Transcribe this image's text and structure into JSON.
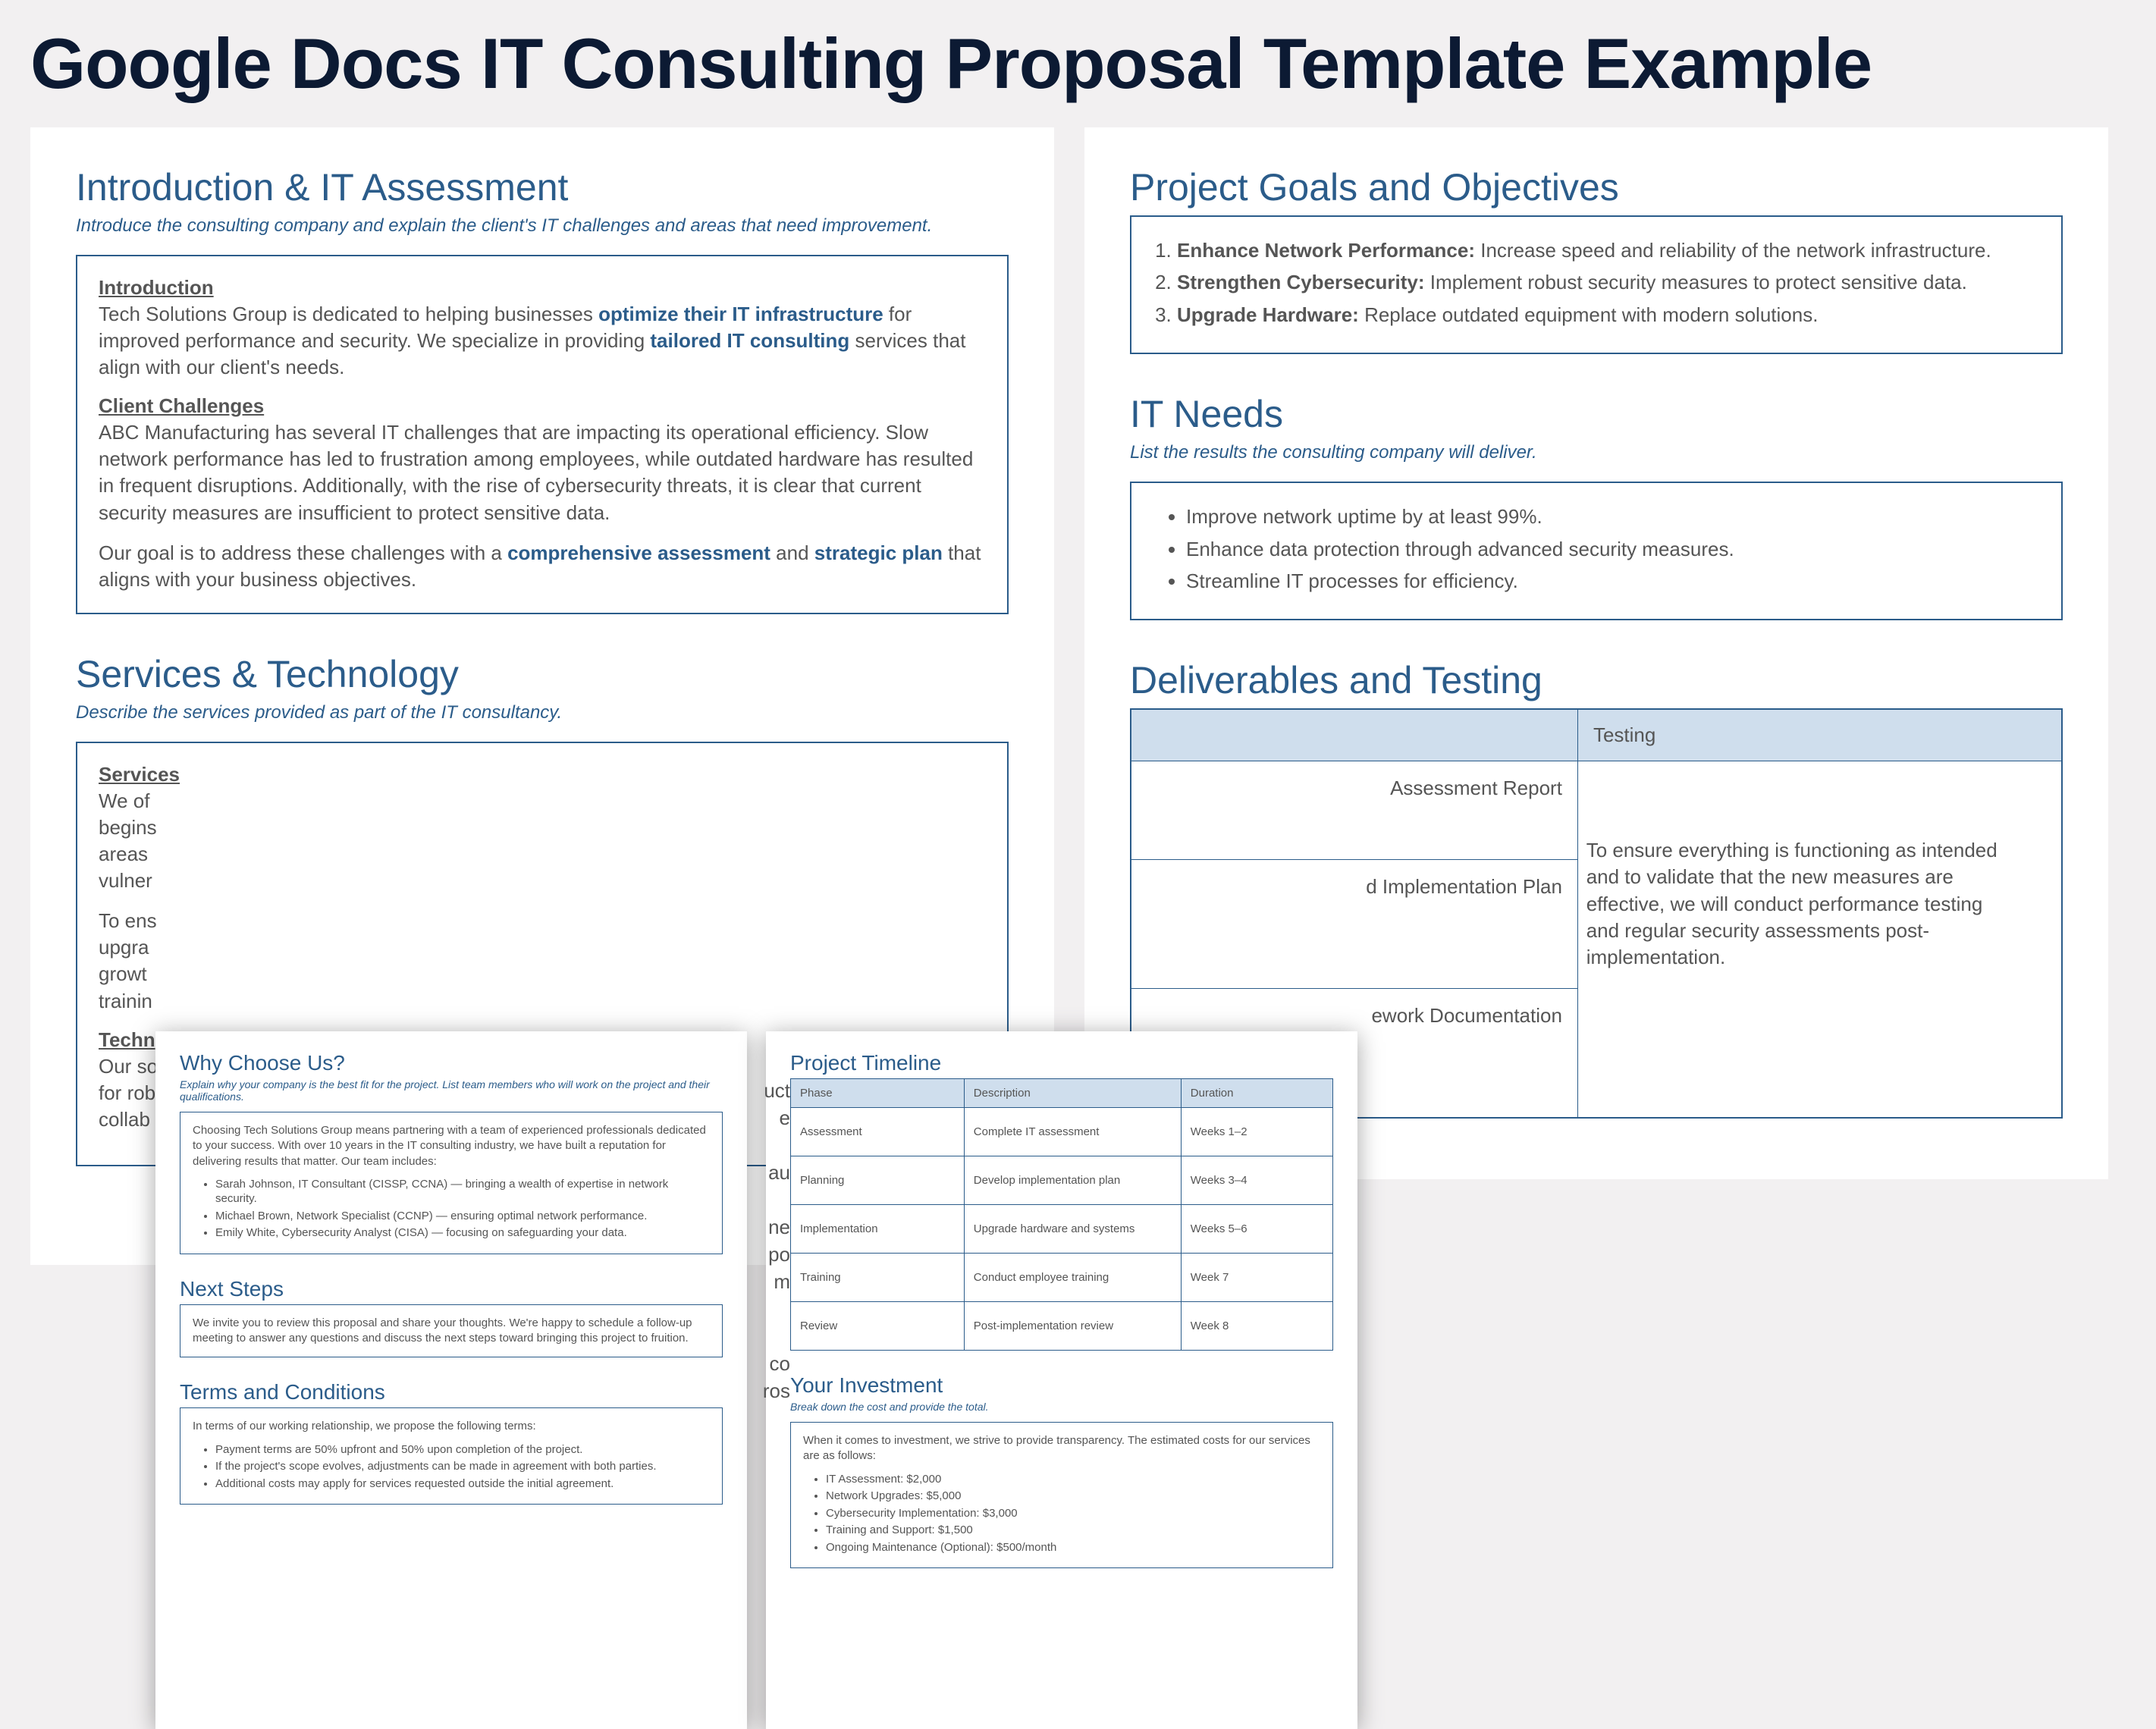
{
  "title": "Google Docs IT Consulting Proposal Template Example",
  "left": {
    "intro_heading": "Introduction & IT Assessment",
    "intro_sub": "Introduce the consulting company and explain the client's IT challenges and areas that need improvement.",
    "intro_label": "Introduction",
    "intro_p1a": "Tech Solutions Group is dedicated to helping businesses ",
    "intro_p1b": "optimize their IT infrastructure",
    "intro_p1c": " for improved performance and security. We specialize in providing ",
    "intro_p1d": "tailored IT consulting",
    "intro_p1e": " services that align with our client's needs.",
    "challenges_label": "Client Challenges",
    "challenges_p": "ABC Manufacturing has several IT challenges that are impacting its operational efficiency. Slow network performance has led to frustration among employees, while outdated hardware has resulted in frequent disruptions. Additionally, with the rise of cybersecurity threats, it is clear that current security measures are insufficient to protect sensitive data.",
    "goal_a": "Our goal is to address these challenges with a ",
    "goal_b": "comprehensive assessment",
    "goal_c": " and ",
    "goal_d": "strategic plan",
    "goal_e": " that aligns with your business objectives.",
    "services_heading": "Services & Technology",
    "services_sub": "Describe the services provided as part of the IT consultancy.",
    "services_label": "Services",
    "services_frag1": "We of",
    "services_frag2": "begins",
    "services_frag3": "areas",
    "services_frag4": "vulner",
    "services_frag5": "To ens",
    "services_frag6": "upgra",
    "services_frag7": "growt",
    "services_frag8": "trainin",
    "tech_label": "Techn",
    "services_frag9": "Our so",
    "services_frag10": "for rob",
    "services_frag11": "collab"
  },
  "right": {
    "goals_heading": "Project Goals and Objectives",
    "goals": [
      {
        "b": "Enhance Network Performance:",
        "t": " Increase speed and reliability of the network infrastructure."
      },
      {
        "b": "Strengthen Cybersecurity:",
        "t": " Implement robust security measures to protect sensitive data."
      },
      {
        "b": "Upgrade Hardware:",
        "t": " Replace outdated equipment with modern solutions."
      }
    ],
    "needs_heading": "IT Needs",
    "needs_sub": "List the results the consulting company will deliver.",
    "needs": [
      "Improve network uptime by at least 99%.",
      "Enhance data protection through advanced security measures.",
      "Streamline IT processes for efficiency."
    ],
    "deliv_heading": "Deliverables and Testing",
    "dt_headers": [
      "",
      "Testing"
    ],
    "dt_rows": [
      [
        "Assessment Report",
        ""
      ],
      [
        "d Implementation Plan",
        "To ensure everything is functioning as intended and to validate that the new measures are effective, we will conduct performance testing and regular security assessments post-implementation."
      ],
      [
        "ework Documentation",
        ""
      ]
    ]
  },
  "miniLeft": {
    "why_heading": "Why Choose Us?",
    "why_sub": "Explain why your company is the best fit for the project. List team members who will work on the project and their qualifications.",
    "why_p": "Choosing Tech Solutions Group means partnering with a team of experienced professionals dedicated to your success. With over 10 years in the IT consulting industry, we have built a reputation for delivering results that matter. Our team includes:",
    "team": [
      "Sarah Johnson, IT Consultant (CISSP, CCNA) — bringing a wealth of expertise in network security.",
      "Michael Brown, Network Specialist (CCNP) — ensuring optimal network performance.",
      "Emily White, Cybersecurity Analyst (CISA) — focusing on safeguarding your data."
    ],
    "next_heading": "Next Steps",
    "next_p": "We invite you to review this proposal and share your thoughts. We're happy to schedule a follow-up meeting to answer any questions and discuss the next steps toward bringing this project to fruition.",
    "terms_heading": "Terms and Conditions",
    "terms_intro": "In terms of our working relationship, we propose the following terms:",
    "terms": [
      "Payment terms are 50% upfront and 50% upon completion of the project.",
      "If the project's scope evolves, adjustments can be made in agreement with both parties.",
      "Additional costs may apply for services requested outside the initial agreement."
    ]
  },
  "miniRight": {
    "timeline_heading": "Project Timeline",
    "tl_headers": [
      "Phase",
      "Description",
      "Duration"
    ],
    "tl_rows": [
      [
        "Assessment",
        "Complete IT assessment",
        "Weeks 1–2"
      ],
      [
        "Planning",
        "Develop implementation plan",
        "Weeks 3–4"
      ],
      [
        "Implementation",
        "Upgrade hardware and systems",
        "Weeks 5–6"
      ],
      [
        "Training",
        "Conduct employee training",
        "Week 7"
      ],
      [
        "Review",
        "Post-implementation review",
        "Week 8"
      ]
    ],
    "invest_heading": "Your Investment",
    "invest_sub": "Break down the cost and provide the total.",
    "invest_intro": "When it comes to investment, we strive to provide transparency. The estimated costs for our services are as follows:",
    "invest_items": [
      "IT Assessment: $2,000",
      "Network Upgrades: $5,000",
      "Cybersecurity Implementation: $3,000",
      "Training and Support: $1,500",
      "Ongoing Maintenance (Optional): $500/month"
    ],
    "frags": {
      "a": "uct",
      "b": "e",
      "c": "au",
      "d": " ne",
      "e": "po",
      "f": "m",
      "g": " co",
      "h": "ros"
    }
  }
}
